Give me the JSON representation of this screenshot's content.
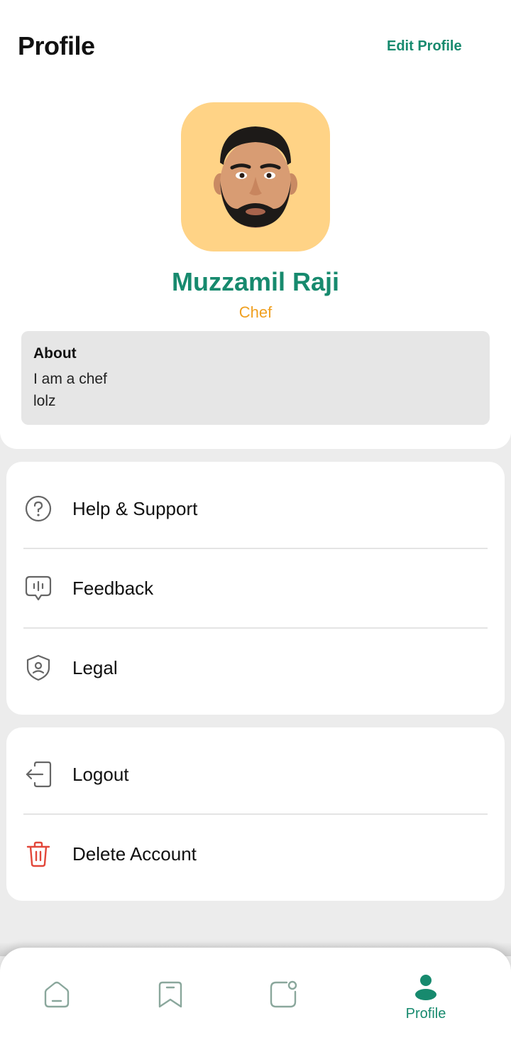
{
  "header": {
    "title": "Profile",
    "edit_label": "Edit Profile"
  },
  "profile": {
    "name": "Muzzamil Raji",
    "role": "Chef",
    "avatar_icon": "memoji-avatar",
    "about_title": "About",
    "about_text": "I am a chef\n lolz"
  },
  "menu": {
    "group1": [
      {
        "label": "Help & Support",
        "icon": "help-circle-icon"
      },
      {
        "label": "Feedback",
        "icon": "feedback-icon"
      },
      {
        "label": "Legal",
        "icon": "shield-user-icon"
      }
    ],
    "group2": [
      {
        "label": "Logout",
        "icon": "logout-icon"
      },
      {
        "label": "Delete Account",
        "icon": "trash-icon"
      }
    ]
  },
  "bottom_nav": {
    "items": [
      {
        "icon": "home-icon"
      },
      {
        "icon": "bookmark-icon"
      },
      {
        "icon": "notification-icon"
      },
      {
        "icon": "profile-icon",
        "label": "Profile",
        "active": true
      }
    ]
  },
  "colors": {
    "accent": "#178a6e",
    "role": "#f0a020",
    "danger": "#e2473a",
    "icon_gray": "#666666",
    "nav_icon": "#8aa79c"
  }
}
